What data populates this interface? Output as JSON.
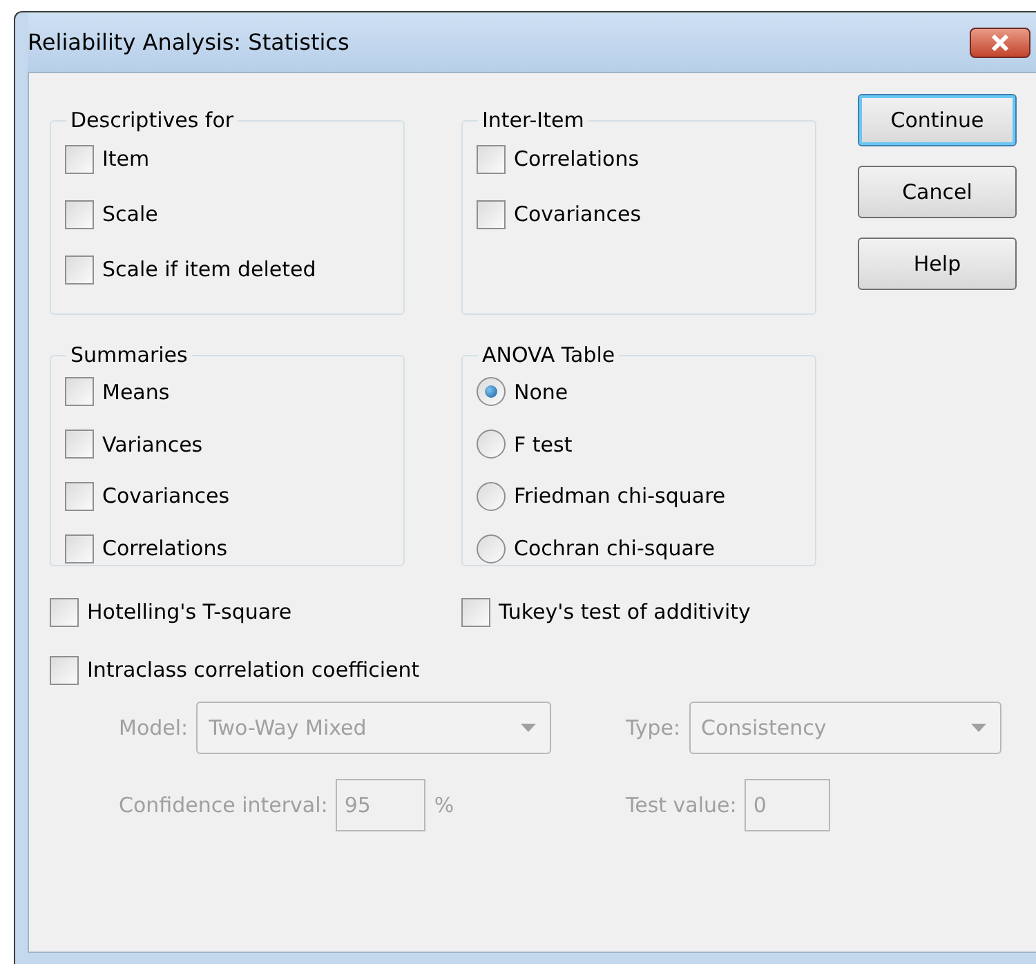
{
  "window": {
    "title": "Reliability Analysis: Statistics"
  },
  "groups": [
    {
      "kind": "checkbox",
      "title": "Descriptives for",
      "items": [
        {
          "label": "Item",
          "checked": false
        },
        {
          "label": "Scale",
          "checked": false
        },
        {
          "label": "Scale if item deleted",
          "checked": false
        }
      ]
    },
    {
      "kind": "checkbox",
      "title": "Inter-Item",
      "items": [
        {
          "label": "Correlations",
          "checked": false
        },
        {
          "label": "Covariances",
          "checked": false
        }
      ]
    },
    {
      "kind": "checkbox",
      "title": "Summaries",
      "items": [
        {
          "label": "Means",
          "checked": false
        },
        {
          "label": "Variances",
          "checked": false
        },
        {
          "label": "Covariances",
          "checked": false
        },
        {
          "label": "Correlations",
          "checked": false
        }
      ]
    },
    {
      "kind": "radio",
      "title": "ANOVA Table",
      "items": [
        {
          "label": "None",
          "selected": true
        },
        {
          "label": "F test",
          "selected": false
        },
        {
          "label": "Friedman chi-square",
          "selected": false
        },
        {
          "label": "Cochran chi-square",
          "selected": false
        }
      ]
    }
  ],
  "buttons": [
    {
      "label": "Continue",
      "focused": true
    },
    {
      "label": "Cancel",
      "focused": false
    },
    {
      "label": "Help",
      "focused": false
    }
  ],
  "options": [
    {
      "label": "Hotelling's T-square",
      "checked": false
    },
    {
      "label": "Tukey's test of additivity",
      "checked": false
    }
  ],
  "intraclass": {
    "label": "Intraclass correlation coefficient",
    "checked": false
  },
  "icc_fields": [
    {
      "kind": "select",
      "label": "Model:",
      "value": "Two-Way Mixed",
      "disabled": true
    },
    {
      "kind": "select",
      "label": "Type:",
      "value": "Consistency",
      "disabled": true
    },
    {
      "kind": "text",
      "label": "Confidence interval:",
      "value": "95",
      "suffix": "%",
      "disabled": true
    },
    {
      "kind": "text",
      "label": "Test value:",
      "value": "0",
      "disabled": true
    }
  ]
}
